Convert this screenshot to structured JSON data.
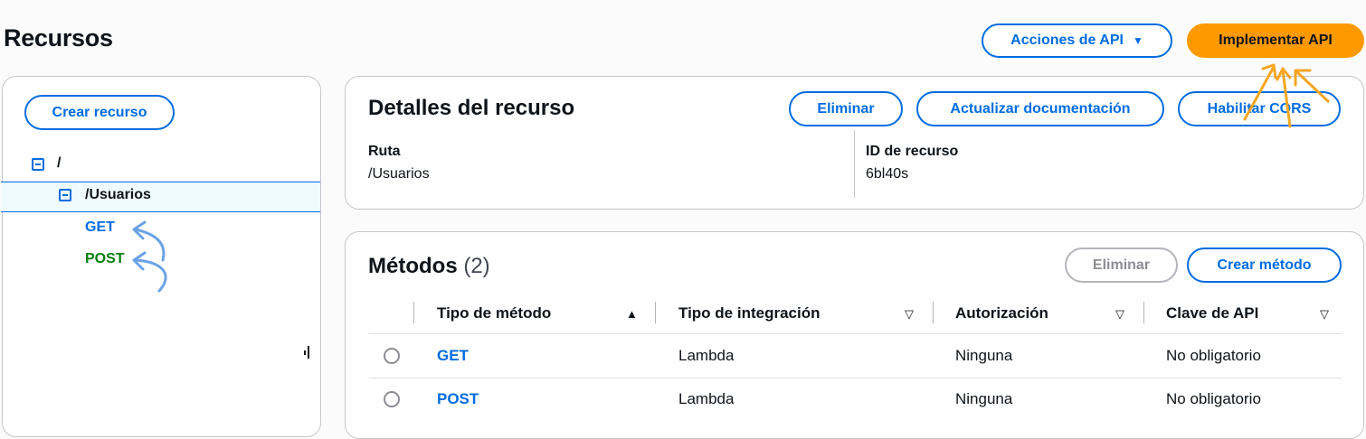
{
  "header": {
    "title": "Recursos",
    "actions_label": "Acciones de API",
    "actions_caret": "▼",
    "deploy_label": "Implementar API"
  },
  "sidebar": {
    "create_resource_label": "Crear recurso",
    "tree": {
      "root": "/",
      "child": "/Usuarios",
      "methods": [
        "GET",
        "POST"
      ]
    }
  },
  "details": {
    "title": "Detalles del recurso",
    "delete_label": "Eliminar",
    "update_docs_label": "Actualizar documentación",
    "enable_cors_label": "Habilitar CORS",
    "path_label": "Ruta",
    "path_value": "/Usuarios",
    "id_label": "ID de recurso",
    "id_value": "6bl40s"
  },
  "methods": {
    "title": "Métodos",
    "count": "(2)",
    "delete_label": "Eliminar",
    "create_label": "Crear método",
    "columns": [
      "Tipo de método",
      "Tipo de integración",
      "Autorización",
      "Clave de API"
    ],
    "sort_asc": "▲",
    "sort_desc": "▽",
    "rows": [
      {
        "method": "GET",
        "integration": "Lambda",
        "auth": "Ninguna",
        "api_key": "No obligatorio"
      },
      {
        "method": "POST",
        "integration": "Lambda",
        "auth": "Ninguna",
        "api_key": "No obligatorio"
      }
    ]
  },
  "colors": {
    "accent": "#006ce0",
    "primary_button": "#ff9900",
    "post_green": "#037f0c",
    "annotation_orange": "#f5a623",
    "annotation_blue": "#6aa3e6"
  }
}
